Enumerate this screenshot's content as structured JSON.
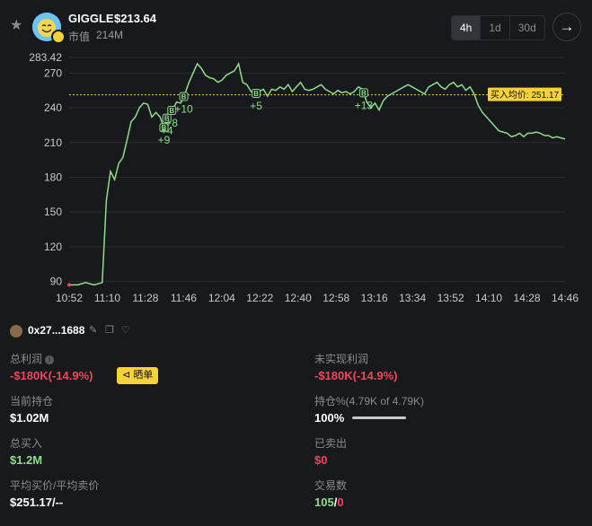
{
  "header": {
    "title": "GIGGLE",
    "price": "$213.64",
    "mcap_label": "市值",
    "mcap_value": "214M",
    "timeframes": [
      "4h",
      "1d",
      "30d"
    ],
    "active_timeframe": "4h",
    "next_icon": "arrow-right-icon",
    "star_icon": "star-icon"
  },
  "chart_data": {
    "type": "line",
    "x_ticks": [
      "10:52",
      "11:10",
      "11:28",
      "11:46",
      "12:04",
      "12:22",
      "12:40",
      "12:58",
      "13:16",
      "13:34",
      "13:52",
      "14:10",
      "14:28",
      "14:46"
    ],
    "y_ticks": [
      90,
      120,
      150,
      180,
      210,
      240,
      270
    ],
    "y_max_label": "283.42",
    "ylim": [
      85,
      285
    ],
    "avg_buy_label": "买入均价: 251.17",
    "avg_buy_value": 251.17,
    "series": [
      {
        "values": [
          87,
          87,
          87,
          88,
          89,
          88,
          87,
          88,
          89,
          160,
          185,
          178,
          192,
          197,
          212,
          228,
          232,
          240,
          244,
          243,
          232,
          236,
          232,
          222,
          236,
          238,
          245,
          244,
          252,
          262,
          270,
          278,
          274,
          268,
          266,
          265,
          262,
          264,
          268,
          270,
          272,
          278,
          262,
          260,
          254,
          252,
          254,
          256,
          250,
          256,
          255,
          258,
          256,
          260,
          254,
          258,
          262,
          256,
          255,
          256,
          258,
          260,
          256,
          254,
          252,
          255,
          253,
          254,
          252,
          254,
          258,
          256,
          245,
          240,
          244,
          238,
          246,
          250,
          252,
          254,
          256,
          258,
          260,
          258,
          256,
          254,
          252,
          258,
          260,
          262,
          258,
          256,
          260,
          262,
          258,
          260,
          255,
          258,
          252,
          242,
          236,
          232,
          228,
          224,
          220,
          219,
          218,
          215,
          216,
          218,
          215,
          218,
          218,
          219,
          218,
          216,
          216,
          214,
          215,
          214,
          213
        ]
      }
    ],
    "buy_markers": [
      {
        "label": "+9",
        "at": 0.191
      },
      {
        "label": "+4",
        "at": 0.197
      },
      {
        "label": "+8",
        "at": 0.207
      },
      {
        "label": "+10",
        "at": 0.231
      },
      {
        "label": "+5",
        "at": 0.377
      },
      {
        "label": "+13",
        "at": 0.594
      }
    ],
    "marker_letter": "B"
  },
  "wallet": {
    "address": "0x27...1688",
    "icons": [
      "edit-icon",
      "copy-icon",
      "tag-icon"
    ]
  },
  "stats": {
    "total_pnl_label": "总利润",
    "total_pnl_value": "-$180K(-14.9%)",
    "share_label": "晒单",
    "unrealized_label": "未实现利润",
    "unrealized_value": "-$180K(-14.9%)",
    "holding_label": "当前持仓",
    "holding_value": "$1.02M",
    "holding_pct_label": "持仓%(4.79K of 4.79K)",
    "holding_pct_value": "100%",
    "holding_pct_fraction": 1.0,
    "total_buy_label": "总买入",
    "total_buy_value": "$1.2M",
    "sold_label": "已卖出",
    "sold_value": "$0",
    "avg_price_label": "平均买价/平均卖价",
    "avg_price_value": "$251.17/--",
    "tx_label": "交易数",
    "tx_buy": "105",
    "tx_sep": "/",
    "tx_sell": "0"
  },
  "colors": {
    "line": "#8ddc8a",
    "avg_line": "#f5d13a",
    "negative": "#f0465e",
    "positive": "#8ddc8a"
  }
}
